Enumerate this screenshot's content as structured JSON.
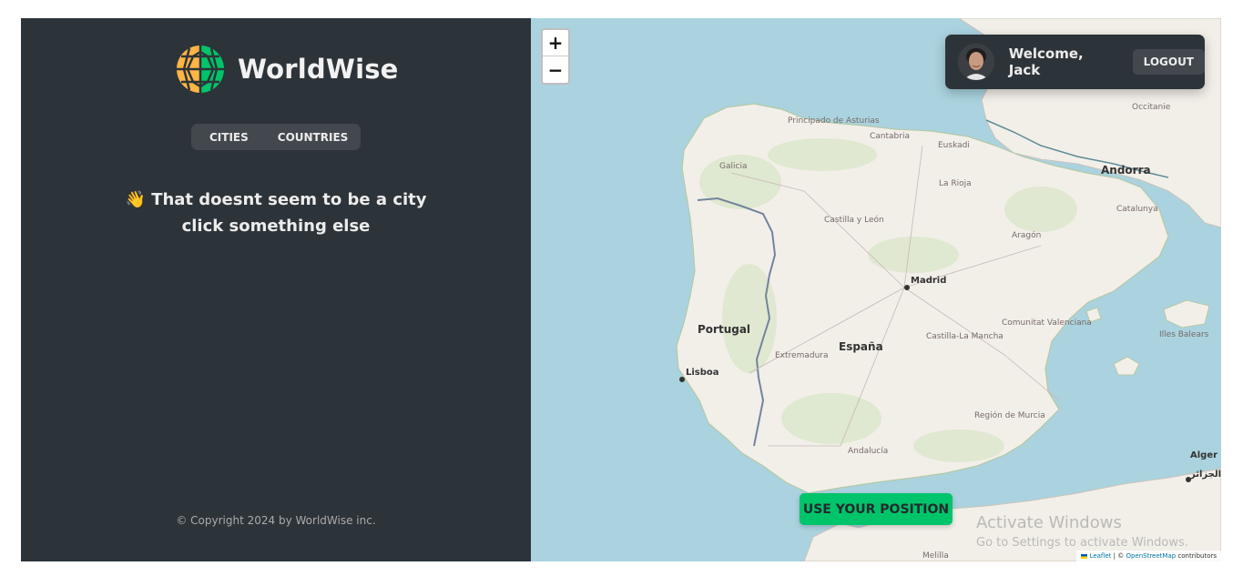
{
  "app": {
    "logo_text": "WorldWise",
    "tabs": [
      {
        "label": "Cities"
      },
      {
        "label": "Countries"
      }
    ],
    "message_emoji": "👋",
    "message_text": "That doesnt seem to be a city click something else",
    "footer": "© Copyright 2024 by WorldWise inc."
  },
  "map": {
    "zoom_in": "+",
    "zoom_out": "−",
    "use_position": "USE YOUR POSITION",
    "attribution_leaflet": "Leaflet",
    "attribution_sep": " | © ",
    "attribution_osm": "OpenStreetMap",
    "attribution_tail": " contributors",
    "labels": {
      "portugal": "Portugal",
      "espana": "España",
      "andorra": "Andorra",
      "madrid": "Madrid",
      "lisboa": "Lisboa",
      "alger": "Alger",
      "alger_ar": "الجزائر",
      "asturias": "Principado de Asturias",
      "cantabria": "Cantabria",
      "euskadi": "Euskadi",
      "galicia": "Galicia",
      "rioja": "La Rioja",
      "occitanie": "Occitanie",
      "catalunya": "Catalunya",
      "aragon": "Aragón",
      "castilla_leon": "Castilla y León",
      "extremadura": "Extremadura",
      "castilla_mancha": "Castilla-La Mancha",
      "valenciana": "Comunitat Valenciana",
      "illes_balears": "Illes Balears",
      "murcia": "Región de Murcia",
      "andalucia": "Andalucía",
      "melilla": "Melilla"
    }
  },
  "user": {
    "welcome": "Welcome, Jack",
    "logout": "Logout"
  },
  "watermark": {
    "line1": "Activate Windows",
    "line2": "Go to Settings to activate Windows."
  },
  "colors": {
    "sidebar_bg": "#2d3439",
    "brand_green": "#00c46a",
    "brand_orange": "#ffb545",
    "sea": "#aad3df",
    "land": "#f2efe9"
  }
}
